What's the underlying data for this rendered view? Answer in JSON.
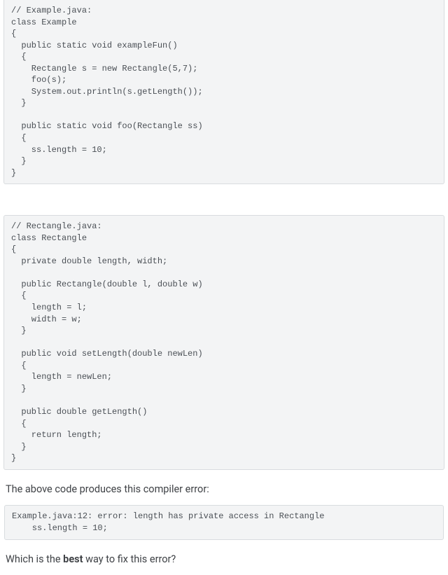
{
  "code1": "// Example.java:\nclass Example\n{\n  public static void exampleFun()\n  {\n    Rectangle s = new Rectangle(5,7);\n    foo(s);\n    System.out.println(s.getLength());\n  }\n\n  public static void foo(Rectangle ss)\n  {\n    ss.length = 10;\n  }\n}",
  "code2": "// Rectangle.java:\nclass Rectangle\n{\n  private double length, width;\n\n  public Rectangle(double l, double w)\n  {\n    length = l;\n    width = w;\n  }\n\n  public void setLength(double newLen)\n  {\n    length = newLen;\n  }\n\n  public double getLength()\n  {\n    return length;\n  }\n}",
  "narration1": "The above code produces this compiler error:",
  "error": "Example.java:12: error: length has private access in Rectangle\n    ss.length = 10;",
  "question_prefix": "Which is the ",
  "question_bold": "best",
  "question_suffix": " way to fix this error?"
}
